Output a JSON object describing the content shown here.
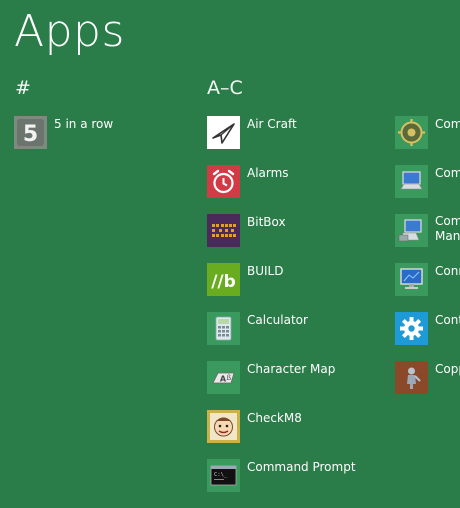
{
  "page": {
    "title": "Apps"
  },
  "groups": {
    "hash": {
      "header": "#"
    },
    "a_c": {
      "header": "A–C"
    }
  },
  "apps": {
    "five_in_a_row": {
      "label": "5 in a row",
      "icon": "five-icon",
      "tile_color": "#7d8a80"
    },
    "air_craft": {
      "label": "Air Craft",
      "icon": "paper-plane-icon",
      "tile_color": "#ffffff"
    },
    "alarms": {
      "label": "Alarms",
      "icon": "alarm-clock-icon",
      "tile_color": "#d23a45"
    },
    "bitbox": {
      "label": "BitBox",
      "icon": "bitbox-grid-icon",
      "tile_color": "#4a2a5a"
    },
    "build": {
      "label": "BUILD",
      "icon": "build-slash-b-icon",
      "tile_color": "#69ac1f"
    },
    "calculator": {
      "label": "Calculator",
      "icon": "calculator-icon",
      "tile_color": "#3a9a5e"
    },
    "character_map": {
      "label": "Character Map",
      "icon": "character-map-icon",
      "tile_color": "#3a9a5e"
    },
    "checkm8": {
      "label": "CheckM8",
      "icon": "checkm8-face-icon",
      "tile_color": "#c8b24a"
    },
    "command_prompt": {
      "label": "Command Prompt",
      "icon": "command-prompt-icon",
      "tile_color": "#3a9a5e"
    },
    "col3_1": {
      "label": "Com",
      "icon": "component-gear-icon",
      "tile_color": "#3a9a5e"
    },
    "col3_2": {
      "label": "Com",
      "icon": "computer-icon",
      "tile_color": "#3a9a5e"
    },
    "col3_3": {
      "label": "Com",
      "label2": "Mana",
      "icon": "computer-management-icon",
      "tile_color": "#3a9a5e"
    },
    "col3_4": {
      "label": "Conr",
      "icon": "monitor-icon",
      "tile_color": "#3a9a5e"
    },
    "col3_5": {
      "label": "Cont",
      "icon": "settings-gear-icon",
      "tile_color": "#1e9ad6"
    },
    "col3_6": {
      "label": "Copp",
      "icon": "copper-figure-icon",
      "tile_color": "#8a4a2a"
    }
  }
}
